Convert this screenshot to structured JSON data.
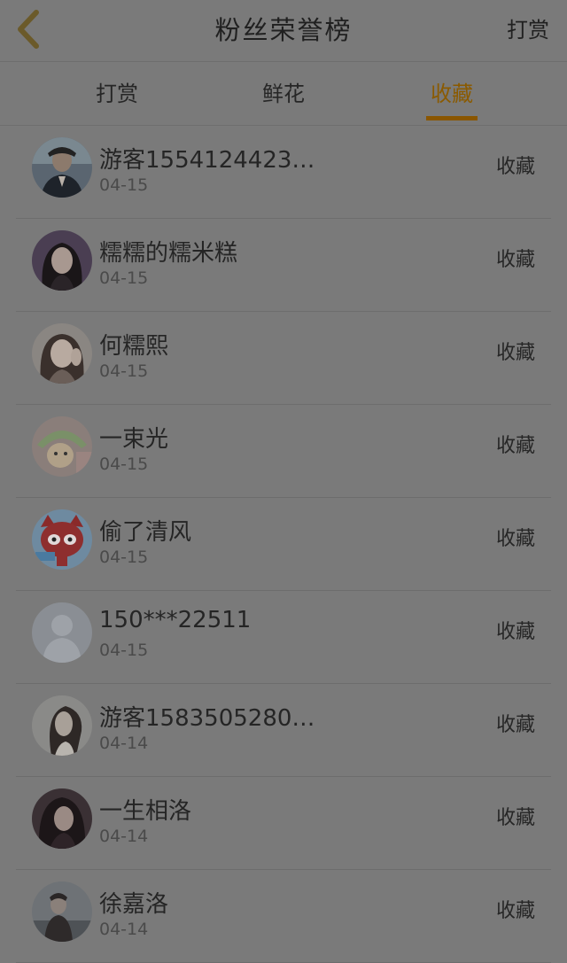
{
  "header": {
    "title": "粉丝荣誉榜",
    "action_label": "打赏",
    "back_icon": "chevron-left-icon",
    "accent_color": "#c8a050"
  },
  "tabs": [
    {
      "label": "打赏",
      "active": false
    },
    {
      "label": "鲜花",
      "active": false
    },
    {
      "label": "收藏",
      "active": true
    }
  ],
  "tab_accent_color": "#8a5600",
  "list": {
    "items": [
      {
        "name": "游客1554124423…",
        "date": "04-15",
        "action": "收藏",
        "avatar": "avatar-man-uniform"
      },
      {
        "name": "糯糯的糯米糕",
        "date": "04-15",
        "action": "收藏",
        "avatar": "avatar-woman-portrait"
      },
      {
        "name": "何糯熙",
        "date": "04-15",
        "action": "收藏",
        "avatar": "avatar-woman-hand"
      },
      {
        "name": "一束光",
        "date": "04-15",
        "action": "收藏",
        "avatar": "avatar-child-hat"
      },
      {
        "name": "偷了清风",
        "date": "04-15",
        "action": "收藏",
        "avatar": "avatar-cartoon-fox"
      },
      {
        "name": "150***22511",
        "date": "04-15",
        "action": "收藏",
        "avatar": "avatar-default-person"
      },
      {
        "name": "游客1583505280…",
        "date": "04-14",
        "action": "收藏",
        "avatar": "avatar-woman-side"
      },
      {
        "name": "一生相洛",
        "date": "04-14",
        "action": "收藏",
        "avatar": "avatar-woman-dark"
      },
      {
        "name": "徐嘉洛",
        "date": "04-14",
        "action": "收藏",
        "avatar": "avatar-figure-outdoor"
      }
    ]
  }
}
